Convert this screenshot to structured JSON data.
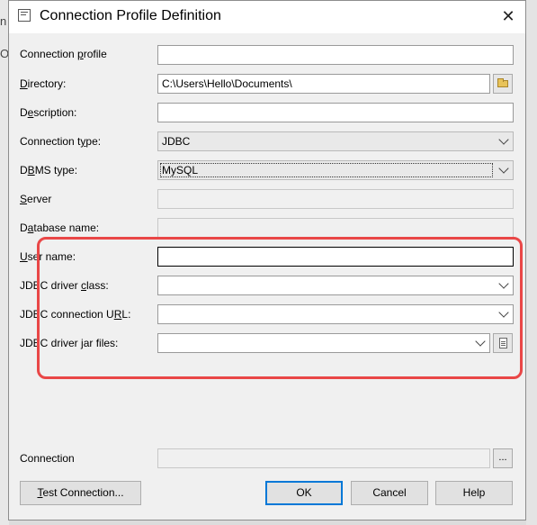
{
  "window": {
    "title": "Connection Profile Definition",
    "close_glyph": "✕"
  },
  "background": {
    "left_chars": [
      "n",
      "O"
    ]
  },
  "form": {
    "connection_profile": {
      "label_pre": "Connection ",
      "label_u": "p",
      "label_post": "rofile",
      "value": ""
    },
    "directory": {
      "label_pre": "",
      "label_u": "D",
      "label_post": "irectory:",
      "value": "C:\\Users\\Hello\\Documents\\",
      "button_icon": "folder-icon"
    },
    "description": {
      "label_pre": "D",
      "label_u": "e",
      "label_post": "scription:",
      "value": ""
    },
    "connection_type": {
      "label_pre": "Connection t",
      "label_u": "y",
      "label_post": "pe:",
      "value": "JDBC"
    },
    "dbms_type": {
      "label_pre": "D",
      "label_u": "B",
      "label_post": "MS type:",
      "value": "MySQL"
    },
    "server": {
      "label_pre": "",
      "label_u": "S",
      "label_post": "erver",
      "value": ""
    },
    "database_name": {
      "label_pre": "D",
      "label_u": "a",
      "label_post": "tabase name:",
      "value": ""
    },
    "user_name": {
      "label_pre": "",
      "label_u": "U",
      "label_post": "ser name:",
      "value": ""
    },
    "jdbc_driver_class": {
      "label_pre": "JDBC driver ",
      "label_u": "c",
      "label_post": "lass:",
      "value": ""
    },
    "jdbc_connection_url": {
      "label_pre": "JDBC connection U",
      "label_u": "R",
      "label_post": "L:",
      "value": ""
    },
    "jdbc_driver_jar_files": {
      "label_pre": "JDBC driver ",
      "label_u": "j",
      "label_post": "ar files:",
      "value": "",
      "button_icon": "document-icon"
    },
    "connection": {
      "label": "Connection",
      "value": "",
      "button_label": "..."
    }
  },
  "buttons": {
    "test_connection": {
      "label_pre": "",
      "label_u": "T",
      "label_post": "est Connection..."
    },
    "ok": "OK",
    "cancel": "Cancel",
    "help": "Help"
  },
  "colors": {
    "highlight": "#e94747",
    "default_button_border": "#0078d7"
  }
}
